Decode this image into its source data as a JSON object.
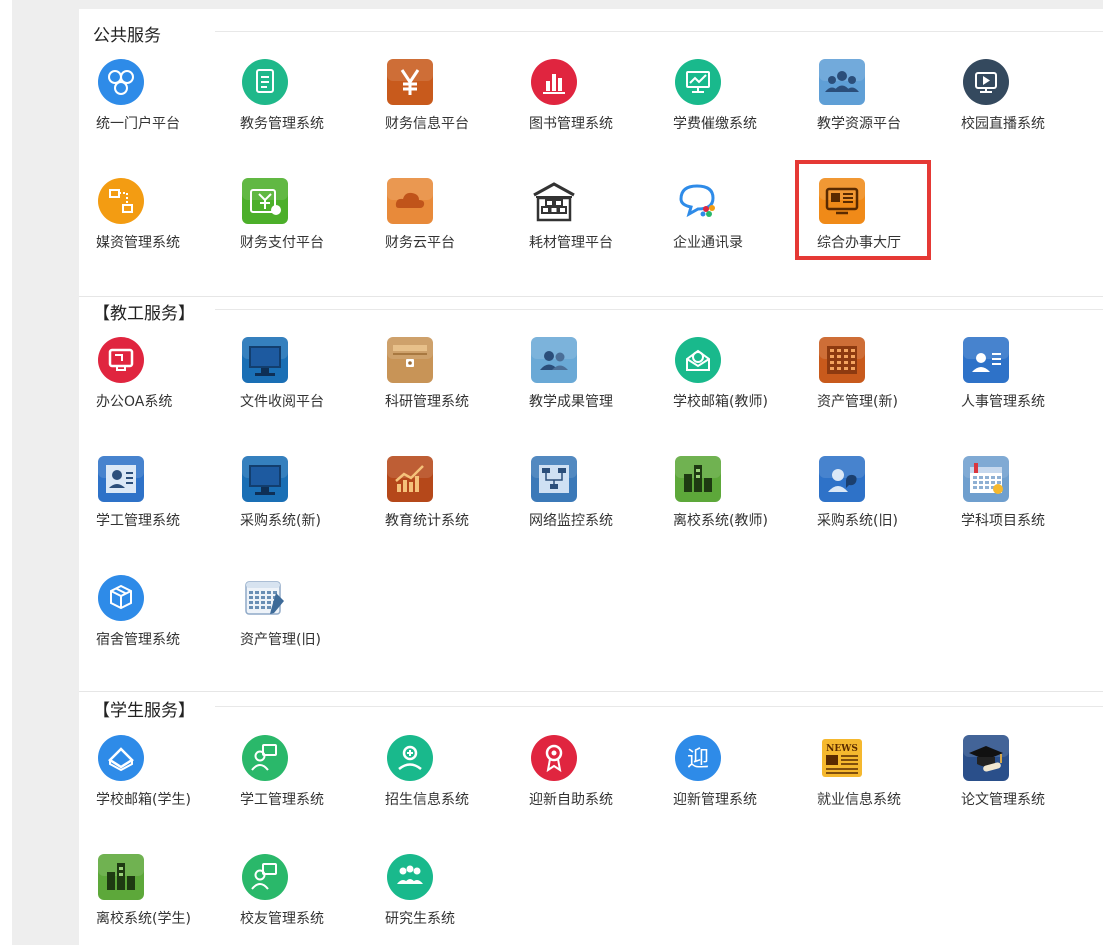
{
  "sections": [
    {
      "title": "公共服务",
      "items": [
        {
          "label": "统一门户平台",
          "icon": "user-group-icon",
          "color": "#2e8be8"
        },
        {
          "label": "教务管理系统",
          "icon": "document-icon",
          "color": "#1fb88a"
        },
        {
          "label": "财务信息平台",
          "icon": "yen-icon",
          "color": "#c85a1c"
        },
        {
          "label": "图书管理系统",
          "icon": "bar-chart-icon",
          "color": "#e0253f"
        },
        {
          "label": "学费催缴系统",
          "icon": "monitor-chart-icon",
          "color": "#19b98c"
        },
        {
          "label": "教学资源平台",
          "icon": "people-icon",
          "color": "#5f9fd6"
        },
        {
          "label": "校园直播系统",
          "icon": "video-play-icon",
          "color": "#34495e"
        },
        {
          "label": "媒资管理系统",
          "icon": "flowchart-icon",
          "color": "#f39c12"
        },
        {
          "label": "财务支付平台",
          "icon": "payment-icon",
          "color": "#4caf2a"
        },
        {
          "label": "财务云平台",
          "icon": "cloud-icon",
          "color": "#e88a3a"
        },
        {
          "label": "耗材管理平台",
          "icon": "warehouse-icon",
          "color": "#333333"
        },
        {
          "label": "企业通讯录",
          "icon": "chat-bubble-icon",
          "color": "#2e8be8"
        },
        {
          "label": "综合办事大厅",
          "icon": "service-hall-icon",
          "color": "#f08a18"
        }
      ]
    },
    {
      "title": "【教工服务】",
      "items": [
        {
          "label": "办公OA系统",
          "icon": "office-icon",
          "color": "#e0253f"
        },
        {
          "label": "文件收阅平台",
          "icon": "computer-monitor-icon",
          "color": "#1a6fb5"
        },
        {
          "label": "科研管理系统",
          "icon": "archive-box-icon",
          "color": "#c89457"
        },
        {
          "label": "教学成果管理",
          "icon": "team-icon",
          "color": "#6aa9d6"
        },
        {
          "label": "学校邮箱(教师)",
          "icon": "mail-icon",
          "color": "#19b98c"
        },
        {
          "label": "资产管理(新)",
          "icon": "calendar-grid-icon",
          "color": "#c85a1c"
        },
        {
          "label": "人事管理系统",
          "icon": "person-card-icon",
          "color": "#2e72c8"
        },
        {
          "label": "学工管理系统",
          "icon": "profile-card-icon",
          "color": "#2e72c8"
        },
        {
          "label": "采购系统(新)",
          "icon": "computer-monitor-icon",
          "color": "#1a6fb5"
        },
        {
          "label": "教育统计系统",
          "icon": "growth-chart-icon",
          "color": "#b5481a"
        },
        {
          "label": "网络监控系统",
          "icon": "network-icon",
          "color": "#3b79b8"
        },
        {
          "label": "离校系统(教师)",
          "icon": "building-icon",
          "color": "#5da83a"
        },
        {
          "label": "采购系统(旧)",
          "icon": "user-chat-icon",
          "color": "#2e72c8"
        },
        {
          "label": "学科项目系统",
          "icon": "calendar-icon",
          "color": "#6f9fce"
        },
        {
          "label": "宿舍管理系统",
          "icon": "boxes-icon",
          "color": "#2e8be8"
        },
        {
          "label": "资产管理(旧)",
          "icon": "spreadsheet-icon",
          "color": "#6a8fb5"
        }
      ]
    },
    {
      "title": "【学生服务】",
      "items": [
        {
          "label": "学校邮箱(学生)",
          "icon": "envelope-open-icon",
          "color": "#2e8be8"
        },
        {
          "label": "学工管理系统",
          "icon": "person-board-icon",
          "color": "#2ab86a"
        },
        {
          "label": "招生信息系统",
          "icon": "person-plus-icon",
          "color": "#19b98c"
        },
        {
          "label": "迎新自助系统",
          "icon": "medal-icon",
          "color": "#e0253f"
        },
        {
          "label": "迎新管理系统",
          "icon": "welcome-icon",
          "color": "#2e8be8"
        },
        {
          "label": "就业信息系统",
          "icon": "news-icon",
          "color": "#f08a18"
        },
        {
          "label": "论文管理系统",
          "icon": "graduation-cap-icon",
          "color": "#2a4f8a"
        },
        {
          "label": "离校系统(学生)",
          "icon": "building-icon",
          "color": "#5da83a"
        },
        {
          "label": "校友管理系统",
          "icon": "person-board-icon",
          "color": "#2ab86a"
        },
        {
          "label": "研究生系统",
          "icon": "group-icon",
          "color": "#19b98c"
        }
      ],
      "icon_glyphs": {
        "welcome-icon": "迎",
        "news-icon": "NEWS"
      }
    }
  ]
}
